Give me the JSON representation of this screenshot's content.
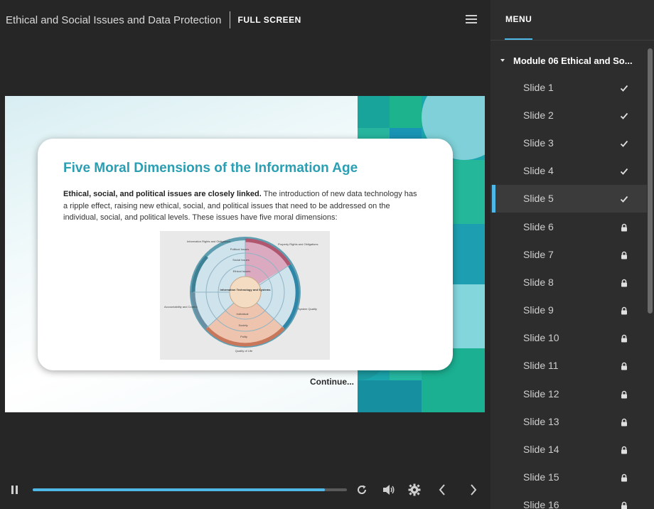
{
  "header": {
    "course_title": "Ethical and Social Issues and Data Protection",
    "fullscreen_label": "FULL SCREEN"
  },
  "slide": {
    "title": "Five Moral Dimensions of the Information Age",
    "body_bold": "Ethical, social, and political issues are closely linked.",
    "body_rest": " The introduction of new data technology has a ripple effect, raising new ethical, social, and political issues that need to be addressed on the individual, social, and political levels. These issues have five moral dimensions:",
    "continue_label": "Continue...",
    "diagram": {
      "labels": {
        "info_rights": "Information Rights and Obligations",
        "property_rights": "Property Rights and Obligations",
        "accountability": "Accountability and Control",
        "system_quality": "System Quality",
        "quality_of_life": "Quality of Life",
        "political": "Political Issues",
        "social": "Social Issues",
        "ethical": "Ethical Issues",
        "center": "Information Technology and Systems",
        "individual": "Individual",
        "society": "Society",
        "polity": "Polity"
      }
    }
  },
  "controls": {
    "progress": 0.93,
    "icons": [
      "pause-icon",
      "replay-icon",
      "volume-icon",
      "settings-icon",
      "prev-icon",
      "next-icon"
    ]
  },
  "menu": {
    "tab_label": "MENU",
    "module_label": "Module 06 Ethical and So...",
    "slides": [
      {
        "label": "Slide 1",
        "status": "done"
      },
      {
        "label": "Slide 2",
        "status": "done"
      },
      {
        "label": "Slide 3",
        "status": "done"
      },
      {
        "label": "Slide 4",
        "status": "done"
      },
      {
        "label": "Slide 5",
        "status": "done",
        "active": true
      },
      {
        "label": "Slide 6",
        "status": "locked"
      },
      {
        "label": "Slide 7",
        "status": "locked"
      },
      {
        "label": "Slide 8",
        "status": "locked"
      },
      {
        "label": "Slide 9",
        "status": "locked"
      },
      {
        "label": "Slide 10",
        "status": "locked"
      },
      {
        "label": "Slide 11",
        "status": "locked"
      },
      {
        "label": "Slide 12",
        "status": "locked"
      },
      {
        "label": "Slide 13",
        "status": "locked"
      },
      {
        "label": "Slide 14",
        "status": "locked"
      },
      {
        "label": "Slide 15",
        "status": "locked"
      },
      {
        "label": "Slide 16",
        "status": "locked"
      }
    ]
  },
  "colors": {
    "accent": "#4fb8e6",
    "title_teal": "#2a9fb3"
  }
}
